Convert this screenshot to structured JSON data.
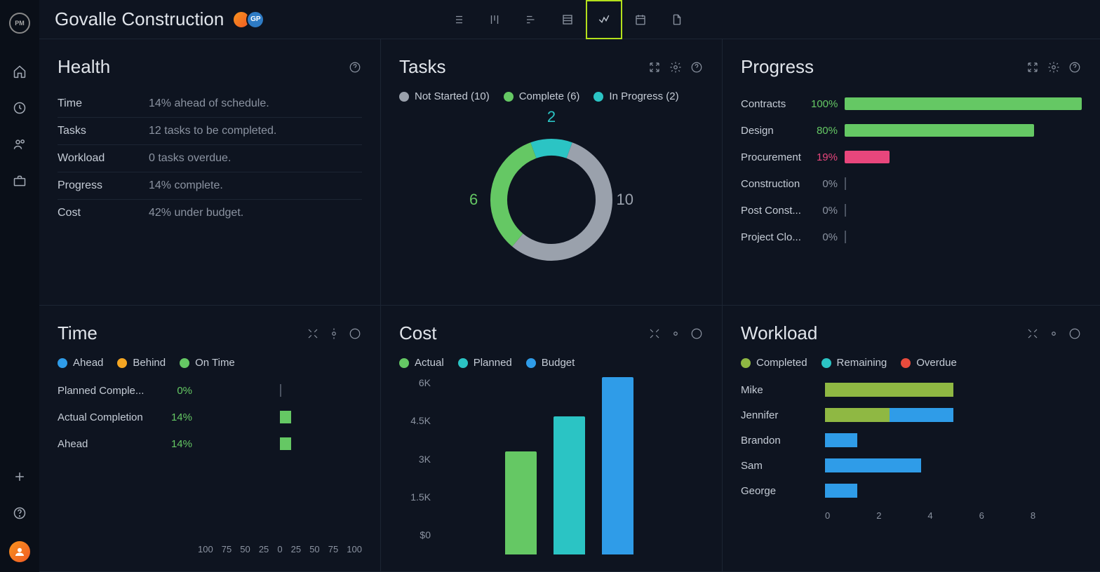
{
  "project": {
    "title": "Govalle Construction",
    "logo": "PM",
    "avatar2_initials": "GP"
  },
  "colors": {
    "green": "#65c864",
    "teal": "#2bc4c4",
    "blue": "#2f9ce8",
    "gray": "#9aa1ac",
    "pink": "#e8467c",
    "olive": "#8fb843",
    "orange": "#f5a623",
    "red": "#e84b3c"
  },
  "health": {
    "title": "Health",
    "rows": [
      {
        "label": "Time",
        "value": "14% ahead of schedule."
      },
      {
        "label": "Tasks",
        "value": "12 tasks to be completed."
      },
      {
        "label": "Workload",
        "value": "0 tasks overdue."
      },
      {
        "label": "Progress",
        "value": "14% complete."
      },
      {
        "label": "Cost",
        "value": "42% under budget."
      }
    ]
  },
  "tasks": {
    "title": "Tasks",
    "legend": [
      {
        "label": "Not Started (10)",
        "color": "#9aa1ac"
      },
      {
        "label": "Complete (6)",
        "color": "#65c864"
      },
      {
        "label": "In Progress (2)",
        "color": "#2bc4c4"
      }
    ],
    "top_label": "2",
    "left_label": "6",
    "right_label": "10",
    "data": {
      "not_started": 10,
      "complete": 6,
      "in_progress": 2
    }
  },
  "progress": {
    "title": "Progress",
    "rows": [
      {
        "label": "Contracts",
        "value": "100%",
        "pct": 100,
        "color": "#65c864",
        "vcolor": "#65c864"
      },
      {
        "label": "Design",
        "value": "80%",
        "pct": 80,
        "color": "#65c864",
        "vcolor": "#65c864"
      },
      {
        "label": "Procurement",
        "value": "19%",
        "pct": 19,
        "color": "#e8467c",
        "vcolor": "#e8467c"
      },
      {
        "label": "Construction",
        "value": "0%",
        "pct": 0,
        "color": "#65c864",
        "vcolor": "#8b93a1"
      },
      {
        "label": "Post Const...",
        "value": "0%",
        "pct": 0,
        "color": "#65c864",
        "vcolor": "#8b93a1"
      },
      {
        "label": "Project Clo...",
        "value": "0%",
        "pct": 0,
        "color": "#65c864",
        "vcolor": "#8b93a1"
      }
    ]
  },
  "time": {
    "title": "Time",
    "legend": [
      {
        "label": "Ahead",
        "color": "#2f9ce8"
      },
      {
        "label": "Behind",
        "color": "#f5a623"
      },
      {
        "label": "On Time",
        "color": "#65c864"
      }
    ],
    "rows": [
      {
        "label": "Planned Comple...",
        "value": "0%",
        "pct": 0
      },
      {
        "label": "Actual Completion",
        "value": "14%",
        "pct": 14
      },
      {
        "label": "Ahead",
        "value": "14%",
        "pct": 14
      }
    ],
    "axis": [
      "100",
      "75",
      "50",
      "25",
      "0",
      "25",
      "50",
      "75",
      "100"
    ]
  },
  "cost": {
    "title": "Cost",
    "legend": [
      {
        "label": "Actual",
        "color": "#65c864"
      },
      {
        "label": "Planned",
        "color": "#2bc4c4"
      },
      {
        "label": "Budget",
        "color": "#2f9ce8"
      }
    ],
    "y_labels": [
      "6K",
      "4.5K",
      "3K",
      "1.5K",
      "$0"
    ],
    "bars": [
      {
        "h": 58,
        "color": "#65c864"
      },
      {
        "h": 78,
        "color": "#2bc4c4"
      },
      {
        "h": 100,
        "color": "#2f9ce8"
      }
    ]
  },
  "workload": {
    "title": "Workload",
    "legend": [
      {
        "label": "Completed",
        "color": "#8fb843"
      },
      {
        "label": "Remaining",
        "color": "#2bc4c4"
      },
      {
        "label": "Overdue",
        "color": "#e84b3c"
      }
    ],
    "max": 8,
    "rows": [
      {
        "name": "Mike",
        "segments": [
          {
            "v": 4,
            "color": "#8fb843"
          }
        ]
      },
      {
        "name": "Jennifer",
        "segments": [
          {
            "v": 2,
            "color": "#8fb843"
          },
          {
            "v": 2,
            "color": "#2f9ce8"
          }
        ]
      },
      {
        "name": "Brandon",
        "segments": [
          {
            "v": 1,
            "color": "#2f9ce8"
          }
        ]
      },
      {
        "name": "Sam",
        "segments": [
          {
            "v": 3,
            "color": "#2f9ce8"
          }
        ]
      },
      {
        "name": "George",
        "segments": [
          {
            "v": 1,
            "color": "#2f9ce8"
          }
        ]
      }
    ],
    "axis": [
      "0",
      "2",
      "4",
      "6",
      "8"
    ]
  },
  "chart_data": [
    {
      "type": "pie",
      "title": "Tasks",
      "series": [
        {
          "name": "Not Started",
          "value": 10
        },
        {
          "name": "Complete",
          "value": 6
        },
        {
          "name": "In Progress",
          "value": 2
        }
      ]
    },
    {
      "type": "bar",
      "title": "Progress",
      "categories": [
        "Contracts",
        "Design",
        "Procurement",
        "Construction",
        "Post Construction",
        "Project Closure"
      ],
      "values": [
        100,
        80,
        19,
        0,
        0,
        0
      ],
      "xlabel": "",
      "ylabel": "",
      "ylim": [
        0,
        100
      ]
    },
    {
      "type": "bar",
      "title": "Time",
      "categories": [
        "Planned Completion",
        "Actual Completion",
        "Ahead"
      ],
      "values": [
        0,
        14,
        14
      ],
      "ylim": [
        -100,
        100
      ]
    },
    {
      "type": "bar",
      "title": "Cost",
      "categories": [
        "Actual",
        "Planned",
        "Budget"
      ],
      "values": [
        3500,
        4700,
        6000
      ],
      "ylabel": "$",
      "ylim": [
        0,
        6000
      ]
    },
    {
      "type": "bar",
      "title": "Workload",
      "categories": [
        "Mike",
        "Jennifer",
        "Brandon",
        "Sam",
        "George"
      ],
      "series": [
        {
          "name": "Completed",
          "values": [
            4,
            2,
            0,
            0,
            0
          ]
        },
        {
          "name": "Remaining",
          "values": [
            0,
            2,
            1,
            3,
            1
          ]
        },
        {
          "name": "Overdue",
          "values": [
            0,
            0,
            0,
            0,
            0
          ]
        }
      ],
      "ylim": [
        0,
        8
      ]
    }
  ]
}
